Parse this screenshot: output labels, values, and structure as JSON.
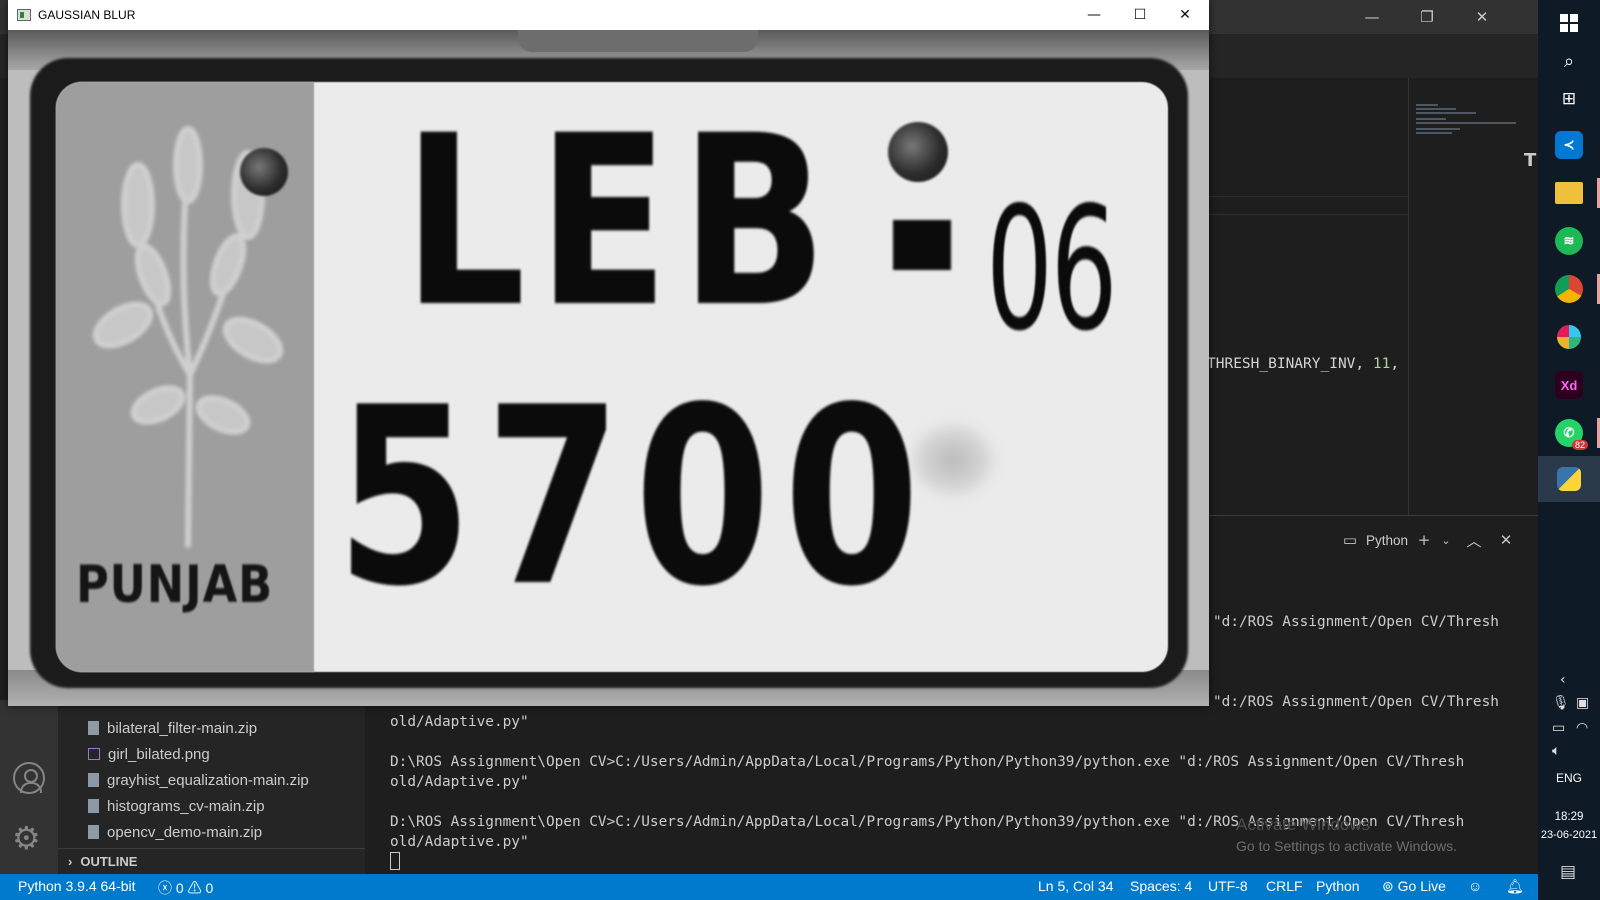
{
  "vscode": {
    "title_controls": {
      "minimize": "—",
      "restore": "❐",
      "close": "✕"
    },
    "editor_code_fragment": {
      "text": "THRESH_BINARY_INV, ",
      "number": "11",
      "suffix": ","
    },
    "panel": {
      "shell_label": "Python",
      "lines": [
        "\"d:/ROS Assignment/Open CV/Thresh",
        "\"d:/ROS Assignment/Open CV/Thresh",
        "old/Adaptive.py\"",
        "D:\\ROS Assignment\\Open CV>C:/Users/Admin/AppData/Local/Programs/Python/Python39/python.exe \"d:/ROS Assignment/Open CV/Thresh",
        "old/Adaptive.py\"",
        "D:\\ROS Assignment\\Open CV>C:/Users/Admin/AppData/Local/Programs/Python/Python39/python.exe \"d:/ROS Assignment/Open CV/Thresh",
        "old/Adaptive.py\""
      ],
      "activate_title": "Activate Windows",
      "activate_sub": "Go to Settings to activate Windows."
    },
    "explorer": {
      "files": [
        {
          "name": "bilateral_filter-main.zip",
          "kind": "zip"
        },
        {
          "name": "girl_bilated.png",
          "kind": "image"
        },
        {
          "name": "grayhist_equalization-main.zip",
          "kind": "zip"
        },
        {
          "name": "histograms_cv-main.zip",
          "kind": "zip"
        },
        {
          "name": "opencv_demo-main.zip",
          "kind": "zip"
        }
      ],
      "outline_label": "OUTLINE"
    },
    "statusbar": {
      "interpreter": "Python 3.9.4 64-bit",
      "errors": "0",
      "warnings": "0",
      "cursor_pos": "Ln 5, Col 34",
      "indent": "Spaces: 4",
      "encoding": "UTF-8",
      "eol": "CRLF",
      "language": "Python",
      "go_live": "Go Live"
    }
  },
  "cv_window": {
    "title": "GAUSSIAN BLUR",
    "controls": {
      "minimize": "—",
      "maximize": "☐",
      "close": "✕"
    },
    "plate": {
      "line1": "LEB",
      "line1_suffix": "06",
      "line2": "5700",
      "region": "PUNJAB"
    }
  },
  "taskbar": {
    "apps": [
      {
        "icon": "windows-start-icon"
      },
      {
        "icon": "search-icon"
      },
      {
        "icon": "task-view-icon"
      },
      {
        "icon": "vscode-icon"
      },
      {
        "icon": "file-explorer-icon"
      },
      {
        "icon": "spotify-icon"
      },
      {
        "icon": "chrome-icon"
      },
      {
        "icon": "slack-icon"
      },
      {
        "icon": "adobe-xd-icon",
        "label": "Xd"
      },
      {
        "icon": "whatsapp-icon",
        "badge": "82"
      },
      {
        "icon": "python-icon"
      }
    ],
    "language": "ENG",
    "time": "18:29",
    "date": "23-06-2021"
  }
}
